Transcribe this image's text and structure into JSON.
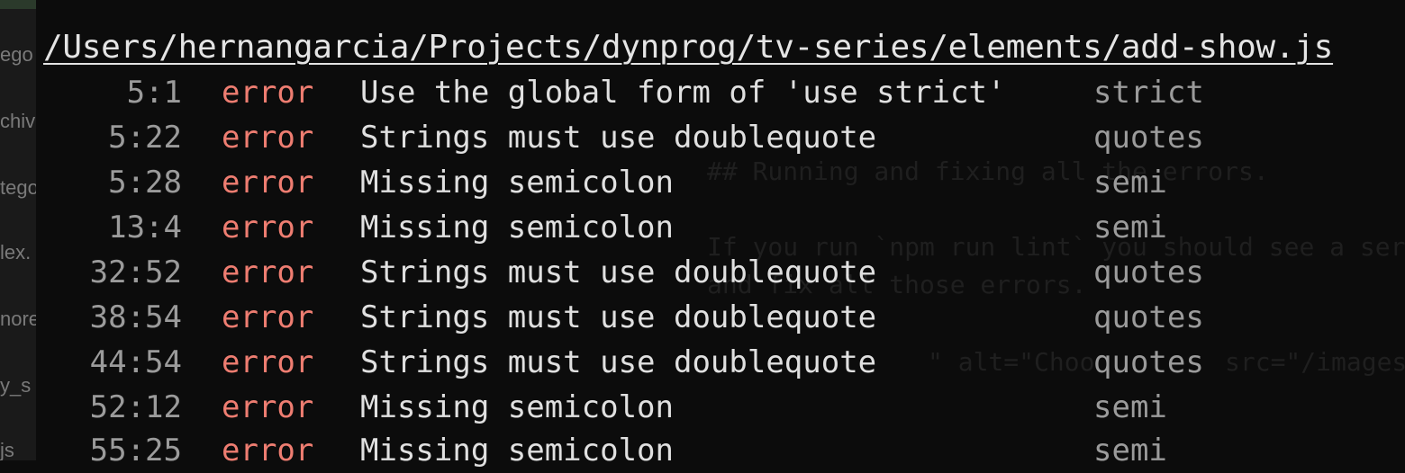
{
  "sidebar": {
    "items": [
      "ego",
      "chive",
      "tegories",
      "lex.",
      "nore",
      "y_s",
      "js"
    ]
  },
  "ghost_editor": {
    "lines": [
      "## Running and fixing all the errors.",
      "If you run `npm run lint` you should see a ser",
      "and fix all those errors.",
      "\" alt=\"Choo",
      "src=\"/images"
    ]
  },
  "terminal": {
    "file_path": "/Users/hernangarcia/Projects/dynprog/tv-series/elements/add-show.js",
    "errors": [
      {
        "location": "5:1",
        "severity": "error",
        "message": "Use the global form of 'use strict'",
        "rule": "strict"
      },
      {
        "location": "5:22",
        "severity": "error",
        "message": "Strings must use doublequote",
        "rule": "quotes"
      },
      {
        "location": "5:28",
        "severity": "error",
        "message": "Missing semicolon",
        "rule": "semi"
      },
      {
        "location": "13:4",
        "severity": "error",
        "message": "Missing semicolon",
        "rule": "semi"
      },
      {
        "location": "32:52",
        "severity": "error",
        "message": "Strings must use doublequote",
        "rule": "quotes"
      },
      {
        "location": "38:54",
        "severity": "error",
        "message": "Strings must use doublequote",
        "rule": "quotes"
      },
      {
        "location": "44:54",
        "severity": "error",
        "message": "Strings must use doublequote",
        "rule": "quotes"
      },
      {
        "location": "52:12",
        "severity": "error",
        "message": "Missing semicolon",
        "rule": "semi"
      },
      {
        "location": "55:25",
        "severity": "error",
        "message": "Missing semicolon",
        "rule": "semi"
      }
    ]
  },
  "colors": {
    "background": "#0c0c0c",
    "error": "#ee7d71",
    "text": "#e0e0e0",
    "dim": "#9b9b9b"
  }
}
